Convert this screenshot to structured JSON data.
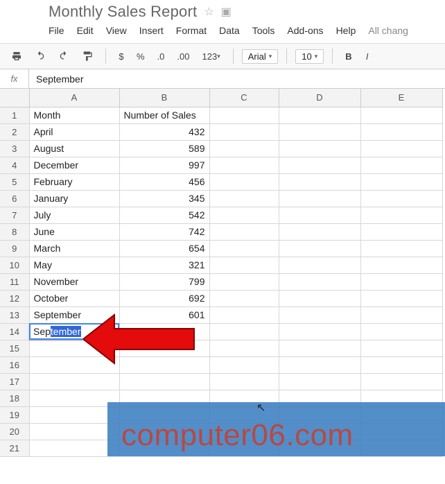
{
  "header": {
    "title": "Monthly Sales Report",
    "menus": [
      "File",
      "Edit",
      "View",
      "Insert",
      "Format",
      "Data",
      "Tools",
      "Add-ons",
      "Help"
    ],
    "status": "All chang"
  },
  "toolbar": {
    "currency": "$",
    "percent": "%",
    "dec_dec": ".0",
    "dec_inc": ".00",
    "numfmt": "123",
    "font": "Arial",
    "size": "10",
    "bold": "B",
    "italic": "I"
  },
  "formula_bar": {
    "label": "fx",
    "value": "September"
  },
  "columns": [
    "A",
    "B",
    "C",
    "D",
    "E"
  ],
  "editing": {
    "typed": "Sep",
    "autocomplete": "tember"
  },
  "chart_data": {
    "type": "table",
    "title": "Monthly Sales Report",
    "columns": [
      "Month",
      "Number of Sales"
    ],
    "rows": [
      {
        "month": "April",
        "sales": 432
      },
      {
        "month": "August",
        "sales": 589
      },
      {
        "month": "December",
        "sales": 997
      },
      {
        "month": "February",
        "sales": 456
      },
      {
        "month": "January",
        "sales": 345
      },
      {
        "month": "July",
        "sales": 542
      },
      {
        "month": "June",
        "sales": 742
      },
      {
        "month": "March",
        "sales": 654
      },
      {
        "month": "May",
        "sales": 321
      },
      {
        "month": "November",
        "sales": 799
      },
      {
        "month": "October",
        "sales": 692
      },
      {
        "month": "September",
        "sales": 601
      }
    ]
  },
  "watermark": "computer06.com"
}
